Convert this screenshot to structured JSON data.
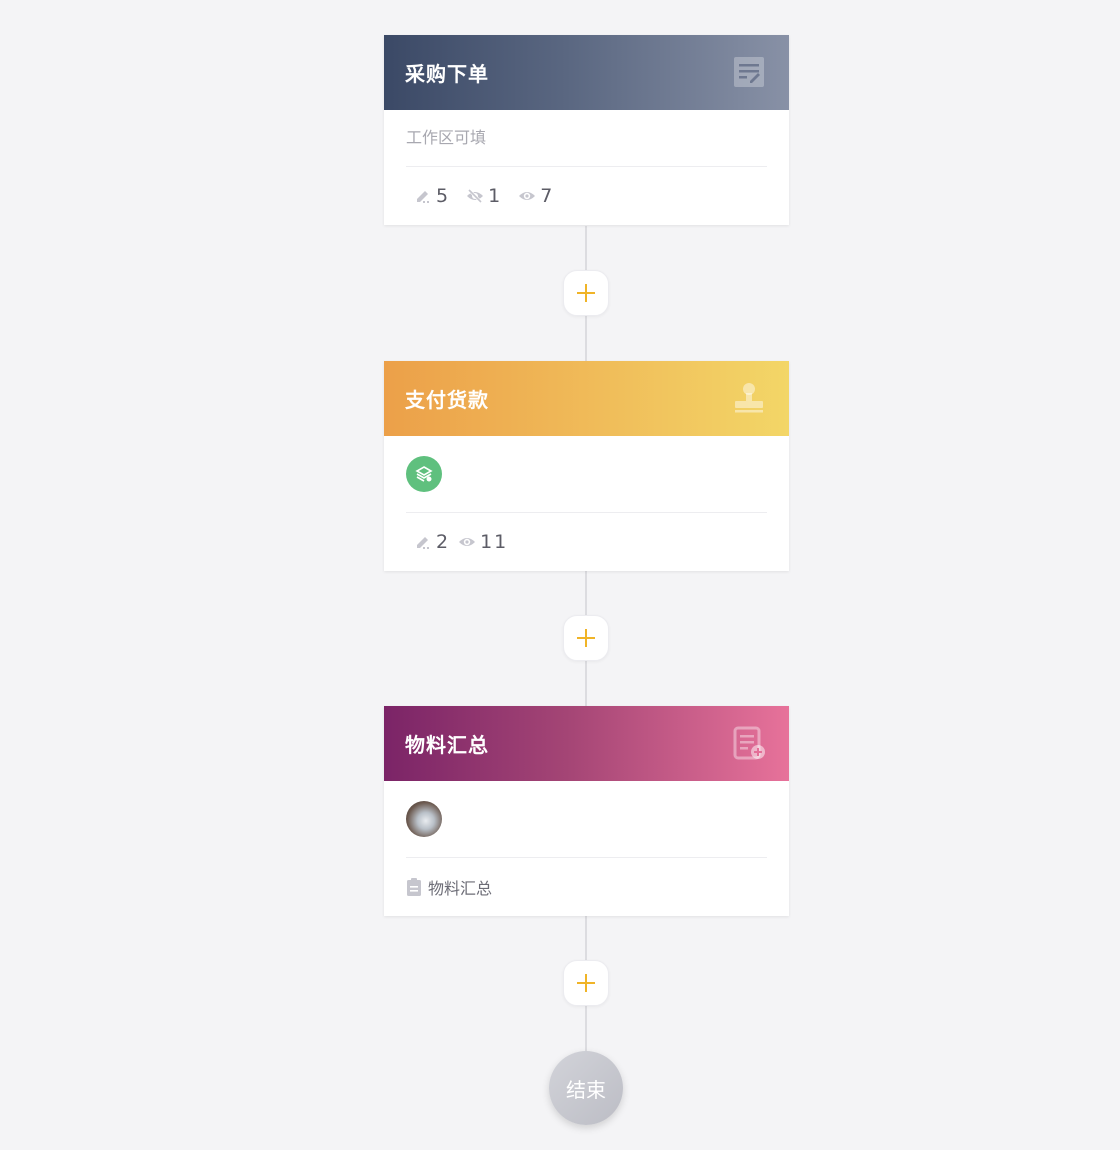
{
  "nodes": [
    {
      "title": "采购下单",
      "header_icon": "edit-form-icon",
      "description": "工作区可填",
      "stats": {
        "editable": "5",
        "hidden": "1",
        "visible": "7"
      }
    },
    {
      "title": "支付货款",
      "header_icon": "stamp-icon",
      "avatar": "layers-avatar-icon",
      "stats": {
        "editable": "2",
        "visible": "11"
      }
    },
    {
      "title": "物料汇总",
      "header_icon": "form-add-icon",
      "avatar": "user-photo-avatar",
      "form_label": "物料汇总"
    }
  ],
  "end_label": "结束",
  "colors": {
    "accent_plus": "#f0b428",
    "header_dark": "#3b4966",
    "header_orange": "#eca049",
    "header_purple": "#7b2467",
    "avatar_green": "#5fc07e"
  }
}
